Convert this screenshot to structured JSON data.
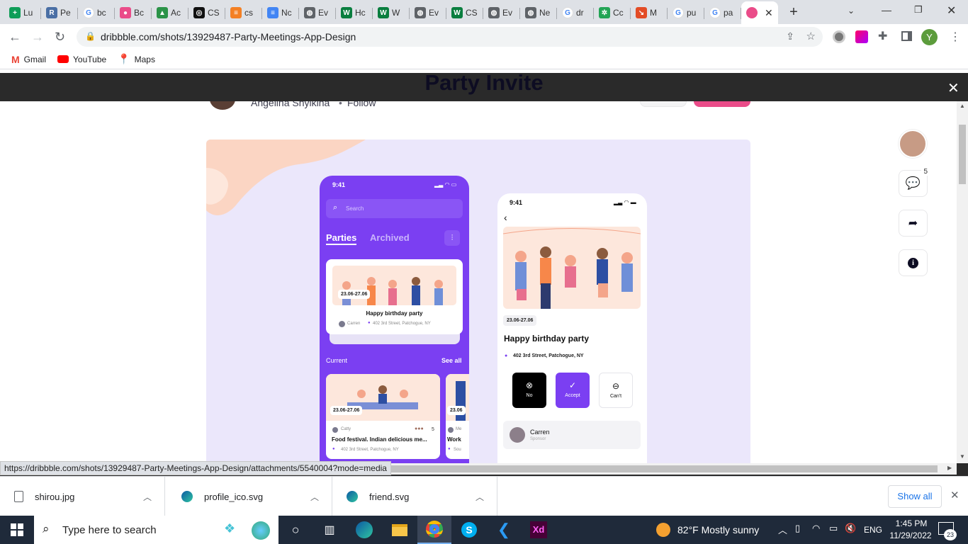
{
  "tabs": [
    {
      "label": "Lu",
      "color": "#0f9d58",
      "glyph": "+"
    },
    {
      "label": "Pe",
      "color": "#4a6fa5",
      "glyph": "R"
    },
    {
      "label": "bc",
      "color": "#ffffff",
      "glyph": "G"
    },
    {
      "label": "Bc",
      "color": "#ea4c89",
      "glyph": "●"
    },
    {
      "label": "Ac",
      "color": "#2b9348",
      "glyph": "▲"
    },
    {
      "label": "CS",
      "color": "#111111",
      "glyph": "◎"
    },
    {
      "label": "cs",
      "color": "#f48024",
      "glyph": "≡"
    },
    {
      "label": "Nc",
      "color": "#4285f4",
      "glyph": "≡"
    },
    {
      "label": "Ev",
      "color": "#5f6368",
      "glyph": "◍"
    },
    {
      "label": "Hc",
      "color": "#0a7e3f",
      "glyph": "W"
    },
    {
      "label": "W",
      "color": "#0a7e3f",
      "glyph": "W"
    },
    {
      "label": "Ev",
      "color": "#5f6368",
      "glyph": "◍"
    },
    {
      "label": "CS",
      "color": "#0a7e3f",
      "glyph": "W"
    },
    {
      "label": "Ev",
      "color": "#5f6368",
      "glyph": "◍"
    },
    {
      "label": "Ne",
      "color": "#5f6368",
      "glyph": "◍"
    },
    {
      "label": "dr",
      "color": "#ffffff",
      "glyph": "G"
    },
    {
      "label": "Cc",
      "color": "#23a455",
      "glyph": "✲"
    },
    {
      "label": "M",
      "color": "#e34c26",
      "glyph": "↘"
    },
    {
      "label": "pu",
      "color": "#ffffff",
      "glyph": "G"
    },
    {
      "label": "pa",
      "color": "#ffffff",
      "glyph": "G"
    }
  ],
  "active_tab_icon": "dribbble-icon",
  "new_tab_label": "+",
  "address_bar": {
    "url": "dribbble.com/shots/13929487-Party-Meetings-App-Design"
  },
  "profile_initial": "Y",
  "bookmarks": [
    {
      "label": "Gmail",
      "icon": "gmail-icon"
    },
    {
      "label": "YouTube",
      "icon": "youtube-icon"
    },
    {
      "label": "Maps",
      "icon": "maps-icon"
    }
  ],
  "shot": {
    "title": "Party Invite",
    "author": "Angelina Shylkina",
    "follow": "Follow",
    "comment_count": "5"
  },
  "phone1": {
    "time": "9:41",
    "search_placeholder": "Search",
    "tab_parties": "Parties",
    "tab_archived": "Archived",
    "card_date": "23.06-27.06",
    "card_title": "Happy birthday party",
    "card_host": "Carren",
    "card_address": "402 3rd Street, Patchogue, NY",
    "section_current": "Current",
    "see_all": "See all",
    "card2_date": "23.06-27.06",
    "card2_host": "Catty",
    "card2_count": "5",
    "card2_title": "Food festival. Indian delicious me...",
    "card2_address": "402 3rd Street, Patchogue, NY",
    "card3_date": "23.06",
    "card3_host": "Me",
    "card3_title": "Work",
    "card3_address": "Sou"
  },
  "phone2": {
    "time": "9:41",
    "date": "23.06-27.06",
    "title": "Happy birthday party",
    "address": "402 3rd Street, Patchogue, NY",
    "btn_no": "No",
    "btn_accept": "Accept",
    "btn_cant": "Can't",
    "sponsor_name": "Carren",
    "sponsor_role": "Sponsor"
  },
  "status_url": "https://dribbble.com/shots/13929487-Party-Meetings-App-Design/attachments/5540004?mode=media",
  "downloads": [
    {
      "name": "shirou.jpg"
    },
    {
      "name": "profile_ico.svg"
    },
    {
      "name": "friend.svg"
    }
  ],
  "show_all": "Show all",
  "taskbar": {
    "search_placeholder": "Type here to search",
    "weather": "82°F  Mostly sunny",
    "lang": "ENG",
    "time": "1:45 PM",
    "date": "11/29/2022",
    "notifications": "23"
  }
}
